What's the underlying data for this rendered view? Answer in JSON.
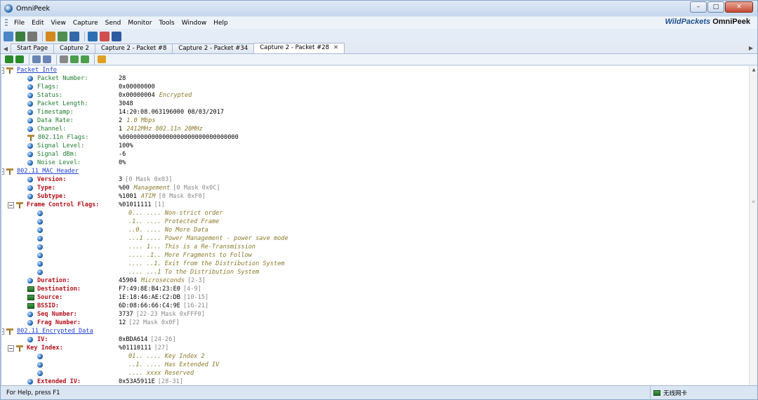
{
  "window": {
    "title": "OmniPeek",
    "min": "–",
    "max": "□",
    "close": "✕"
  },
  "menu": [
    "File",
    "Edit",
    "View",
    "Capture",
    "Send",
    "Monitor",
    "Tools",
    "Window",
    "Help"
  ],
  "brand": {
    "text": "WildPackets",
    "bold": "OmniPeek"
  },
  "tabs": [
    "Start Page",
    "Capture 2",
    "Capture 2 - Packet #8",
    "Capture 2 - Packet #34",
    "Capture 2 - Packet #28"
  ],
  "active_tab_close": "✕",
  "toolbar_icons": [
    "open-icon",
    "save-icon",
    "print-icon",
    "capture-icon",
    "filter-icon",
    "decode-icon",
    "graph-icon",
    "wireless-icon",
    "help-icon"
  ],
  "packet_toolbar_icons": [
    "back-icon",
    "forward-icon",
    "decode-view-icon",
    "hex-view-icon",
    "find-icon",
    "expand-icon",
    "collapse-icon",
    "edit-icon"
  ],
  "tree": [
    {
      "indent": 0,
      "toggle": "−",
      "icon": "tree",
      "label": "Packet Info",
      "style": "lnk",
      "value": "",
      "note": ""
    },
    {
      "indent": 2,
      "icon": "bulb",
      "label": "Packet Number:",
      "style": "green",
      "value": "28"
    },
    {
      "indent": 2,
      "icon": "bulb",
      "label": "Flags:",
      "style": "green",
      "value": "0x00000000"
    },
    {
      "indent": 2,
      "icon": "bulb",
      "label": "Status:",
      "style": "green",
      "value": "0x00000004",
      "note": "Encrypted"
    },
    {
      "indent": 2,
      "icon": "bulb",
      "label": "Packet Length:",
      "style": "green",
      "value": "3048"
    },
    {
      "indent": 2,
      "icon": "bulb",
      "label": "Timestamp:",
      "style": "green",
      "value": "14:20:08.063196000 08/03/2017"
    },
    {
      "indent": 2,
      "icon": "bulb",
      "label": "Data Rate:",
      "style": "green",
      "value": "2",
      "note": "1.0 Mbps"
    },
    {
      "indent": 2,
      "icon": "bulb",
      "label": "Channel:",
      "style": "green",
      "value": "1",
      "note": "2412MHz  802.11n 20MHz"
    },
    {
      "indent": 2,
      "icon": "tree",
      "label": "802.11n Flags:",
      "style": "green",
      "value": "%00000000000000000000000000000000"
    },
    {
      "indent": 2,
      "icon": "bulb",
      "label": "Signal Level:",
      "style": "green",
      "value": "100%"
    },
    {
      "indent": 2,
      "icon": "bulb",
      "label": "Signal dBm:",
      "style": "green",
      "value": "-6"
    },
    {
      "indent": 2,
      "icon": "bulb",
      "label": "Noise Level:",
      "style": "green",
      "value": "0%"
    },
    {
      "indent": 0,
      "toggle": "−",
      "icon": "tree",
      "label": "802.11 MAC Header",
      "style": "lnk",
      "value": ""
    },
    {
      "indent": 2,
      "icon": "bulb",
      "label": "Version:",
      "style": "red",
      "value": "3",
      "dim": "[0 Mask 0x03]"
    },
    {
      "indent": 2,
      "icon": "bulb",
      "label": "Type:",
      "style": "red",
      "value": "%00",
      "note": "Management",
      "dim": "[0 Mask 0x0C]"
    },
    {
      "indent": 2,
      "icon": "bulb",
      "label": "Subtype:",
      "style": "red",
      "value": "%1001",
      "note": "ATIM",
      "dim": "[0 Mask 0xF0]"
    },
    {
      "indent": 1,
      "toggle": "−",
      "icon": "tree",
      "label": "Frame Control Flags:",
      "style": "red",
      "value": "%01011111",
      "dim": "[1]"
    },
    {
      "indent": 3,
      "icon": "bulb",
      "label": "",
      "value": "",
      "sub": "0... .... Non-strict order"
    },
    {
      "indent": 3,
      "icon": "bulb",
      "label": "",
      "value": "",
      "sub": ".1.. .... Protected Frame"
    },
    {
      "indent": 3,
      "icon": "bulb",
      "label": "",
      "value": "",
      "sub": "..0. .... No More Data"
    },
    {
      "indent": 3,
      "icon": "bulb",
      "label": "",
      "value": "",
      "sub": "...1 .... Power Management - power save mode"
    },
    {
      "indent": 3,
      "icon": "bulb",
      "label": "",
      "value": "",
      "sub": ".... 1... This is a Re-Transmission"
    },
    {
      "indent": 3,
      "icon": "bulb",
      "label": "",
      "value": "",
      "sub": ".... .1.. More Fragments to Follow"
    },
    {
      "indent": 3,
      "icon": "bulb",
      "label": "",
      "value": "",
      "sub": ".... ..1. Exit from the Distribution System"
    },
    {
      "indent": 3,
      "icon": "bulb",
      "label": "",
      "value": "",
      "sub": ".... ...1 To the Distribution System"
    },
    {
      "indent": 2,
      "icon": "bulb",
      "label": "Duration:",
      "style": "red",
      "value": "45904",
      "note": "Microseconds",
      "dim": "[2-3]"
    },
    {
      "indent": 2,
      "icon": "net",
      "label": "Destination:",
      "style": "red",
      "value": "F7:49:8E:B4:23:E0",
      "dim": "[4-9]"
    },
    {
      "indent": 2,
      "icon": "net",
      "label": "Source:",
      "style": "red",
      "value": "1E:18:46:AE:C2:DB",
      "dim": "[10-15]"
    },
    {
      "indent": 2,
      "icon": "net",
      "label": "BSSID:",
      "style": "red",
      "value": "6D:08:66:66:C4:9E",
      "dim": "[16-21]"
    },
    {
      "indent": 2,
      "icon": "bulb",
      "label": "Seq Number:",
      "style": "red",
      "value": "3737",
      "dim": "[22-23 Mask 0xFFF0]"
    },
    {
      "indent": 2,
      "icon": "bulb",
      "label": "Frag Number:",
      "style": "red",
      "value": "12",
      "dim": "[22 Mask 0x0F]"
    },
    {
      "indent": 0,
      "toggle": "−",
      "icon": "tree",
      "label": "802.11 Encrypted Data",
      "style": "lnk",
      "value": ""
    },
    {
      "indent": 2,
      "icon": "bulb",
      "label": "IV:",
      "style": "red",
      "value": "0xBDA614",
      "dim": "[24-26]"
    },
    {
      "indent": 1,
      "toggle": "−",
      "icon": "tree",
      "label": "Key Index:",
      "style": "red",
      "value": "%01110111",
      "dim": "[27]"
    },
    {
      "indent": 3,
      "icon": "bulb",
      "label": "",
      "value": "",
      "sub": "01.. .... Key Index 2"
    },
    {
      "indent": 3,
      "icon": "bulb",
      "label": "",
      "value": "",
      "sub": "..1. .... Has Extended IV"
    },
    {
      "indent": 3,
      "icon": "bulb",
      "label": "",
      "value": "",
      "sub": ".... xxxx Reserved"
    },
    {
      "indent": 2,
      "icon": "bulb",
      "label": "Extended IV:",
      "style": "red",
      "value": "0x53A5911E",
      "dim": "[28-31]"
    }
  ],
  "status": {
    "help": "For Help, press F1",
    "adapter": "无线网卡"
  }
}
